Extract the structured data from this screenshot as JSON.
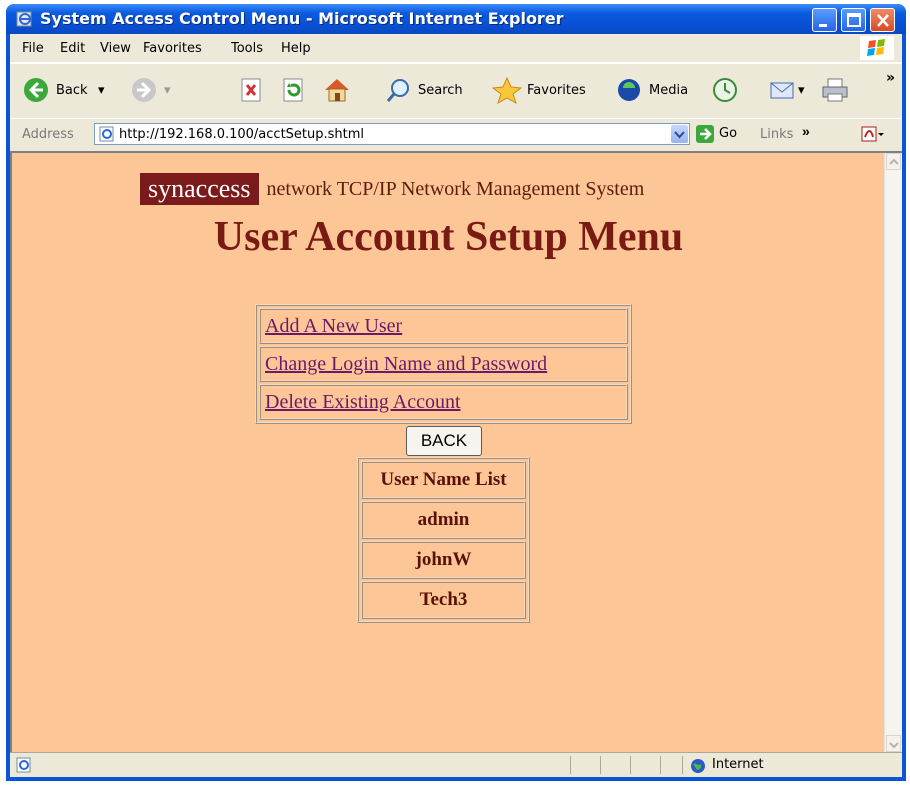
{
  "window": {
    "title": "System Access Control Menu - Microsoft Internet Explorer"
  },
  "menubar": {
    "items": [
      "File",
      "Edit",
      "View",
      "Favorites",
      "Tools",
      "Help"
    ]
  },
  "toolbar": {
    "back_label": "Back",
    "search_label": "Search",
    "favorites_label": "Favorites",
    "media_label": "Media"
  },
  "address": {
    "label": "Address",
    "url": "http://192.168.0.100/acctSetup.shtml",
    "go_label": "Go",
    "links_label": "Links"
  },
  "page": {
    "brand_logo": "synaccess",
    "brand_text": "network TCP/IP Network Management System",
    "heading": "User Account Setup Menu",
    "menu_links": [
      "Add A New User",
      "Change Login Name and Password",
      "Delete Existing Account"
    ],
    "back_button": "BACK",
    "user_list_header": "User Name List",
    "users": [
      "admin",
      "johnW",
      "Tech3"
    ]
  },
  "status": {
    "zone": "Internet"
  },
  "colors": {
    "page_bg": "#fdc696",
    "brand_bg": "#7b1a1a",
    "heading": "#7a1a14",
    "link": "#6a1a6a"
  }
}
